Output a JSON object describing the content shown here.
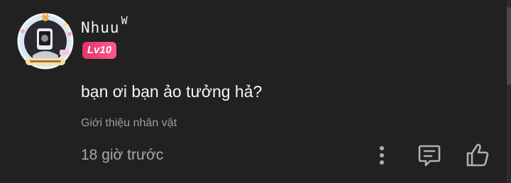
{
  "comment": {
    "username": "Nhuu",
    "username_suffix": "W",
    "level_badge": "Lv10",
    "text": "bạn ơi bạn ảo tưởng hả?",
    "intro_link": "Giới thiệu nhân vật",
    "timestamp": "18 giờ trước"
  },
  "icons": {
    "more": "more-vertical-icon",
    "reply": "comment-icon",
    "like": "thumbs-up-icon"
  },
  "colors": {
    "background": "#212121",
    "badge_start": "#e4336a",
    "badge_end": "#ff5b8a",
    "primary_text": "#f5f5f5",
    "secondary_text": "#9e9e9e"
  }
}
